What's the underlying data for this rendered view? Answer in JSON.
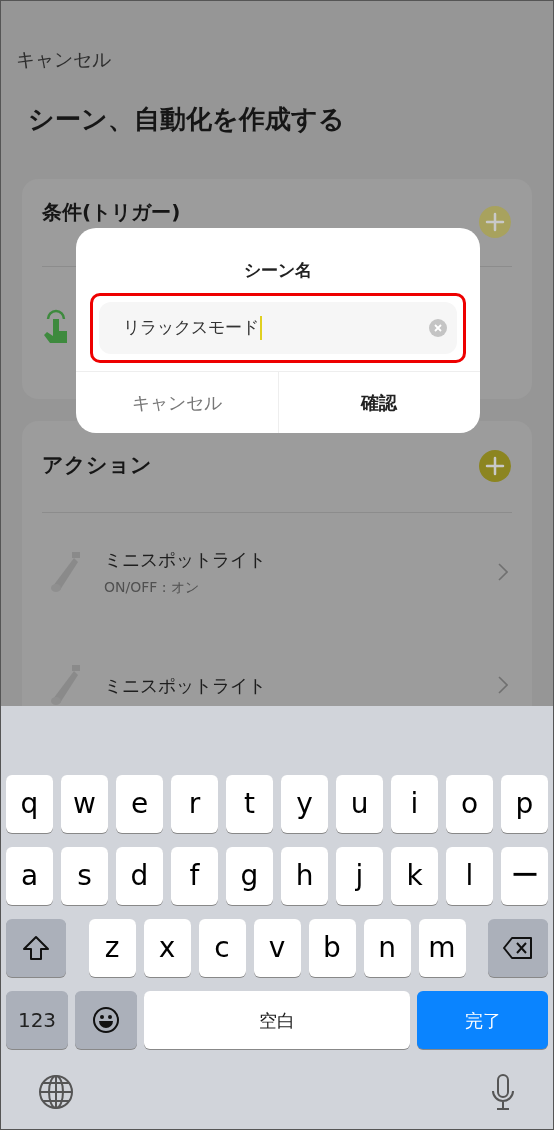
{
  "header": {
    "cancel": "キャンセル",
    "title": "シーン、自動化を作成する"
  },
  "trigger_card": {
    "title": "条件(トリガー)"
  },
  "action_card": {
    "title": "アクション",
    "items": [
      {
        "name": "ミニスポットライト",
        "detail": "ON/OFF : オン"
      },
      {
        "name": "ミニスポットライト"
      }
    ]
  },
  "dialog": {
    "title": "シーン名",
    "value": "リラックスモード",
    "buttons": [
      {
        "label": "キャンセル",
        "kind": "cancel"
      },
      {
        "label": "確認",
        "kind": "confirm"
      }
    ]
  },
  "keyboard": {
    "rows": [
      [
        "q",
        "w",
        "e",
        "r",
        "t",
        "y",
        "u",
        "i",
        "o",
        "p"
      ],
      [
        "a",
        "s",
        "d",
        "f",
        "g",
        "h",
        "j",
        "k",
        "l",
        "ー"
      ],
      [
        "z",
        "x",
        "c",
        "v",
        "b",
        "n",
        "m"
      ]
    ],
    "number_key": "123",
    "space": "空白",
    "done": "完了"
  }
}
